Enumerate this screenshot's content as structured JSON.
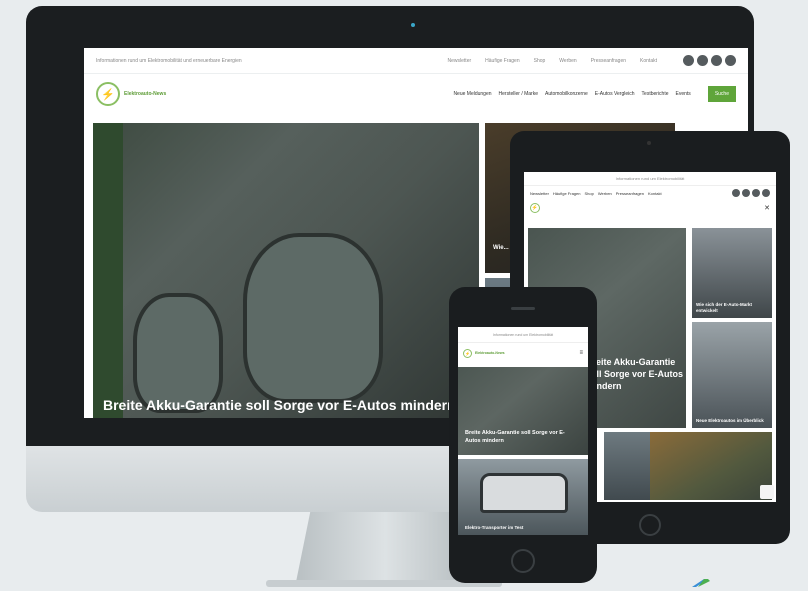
{
  "desktop": {
    "tagline": "Informationen rund um Elektromobilität und erneuerbare Energien",
    "top_nav": [
      "Newsletter",
      "Häufige Fragen",
      "Shop",
      "Werben",
      "Presseanfragen",
      "Kontakt"
    ],
    "logo_text": "Elektroauto-News",
    "main_nav": [
      "Neue Meldungen",
      "Hersteller / Marke",
      "Automobilkonzerne",
      "E-Autos Vergleich",
      "Testberichte",
      "Events"
    ],
    "search_button": "Suche",
    "hero_title": "Breite Akku-Garantie soll Sorge vor E-Autos mindern",
    "side_card_title": "Wie..."
  },
  "tablet": {
    "top_text": "Informationen rund um Elektromobilität",
    "nav": [
      "Newsletter",
      "Häufige Fragen",
      "Shop",
      "Werben",
      "Presseanfragen",
      "Kontakt"
    ],
    "hero_title": "Breite Akku-Garantie soll Sorge vor E-Autos mindern",
    "card1_title": "Wie sich der E-Auto-Markt entwickelt",
    "card2_title": "Neue Elektroautos im Überblick"
  },
  "phone": {
    "top_text": "Informationen rund um Elektromobilität",
    "logo_text": "Elektroauto-News",
    "hero_title": "Breite Akku-Garantie soll Sorge vor E-Autos mindern",
    "card_title": "Elektro-Transporter im Test"
  },
  "icons": {
    "logo": "charging-car-logo-icon",
    "menu": "hamburger-menu-icon",
    "social": [
      "facebook-icon",
      "twitter-icon",
      "youtube-icon",
      "instagram-icon"
    ]
  },
  "colors": {
    "brand_green": "#5fa53a",
    "device_dark": "#1a1d1f",
    "background": "#e8ecee"
  }
}
